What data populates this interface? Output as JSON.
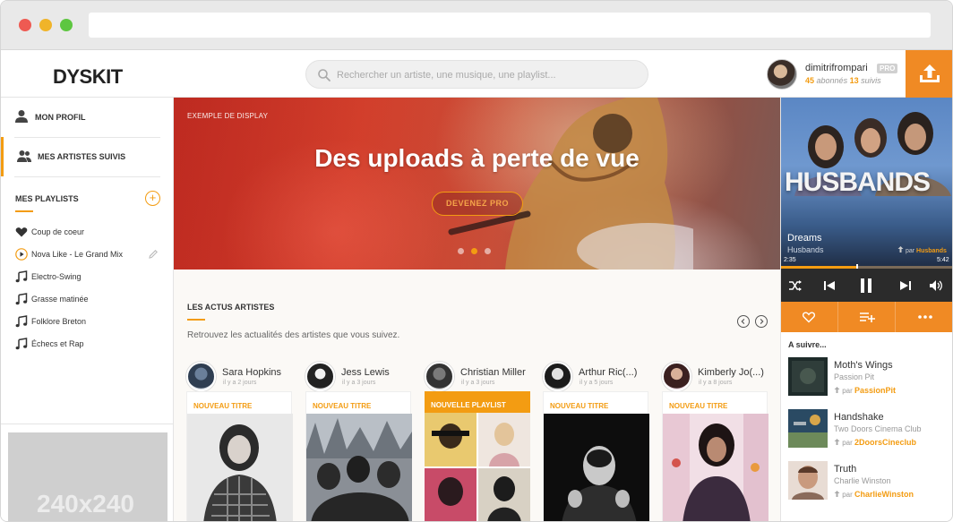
{
  "header": {
    "logo": "DYSKIT",
    "search_placeholder": "Rechercher un artiste, une musique, une playlist...",
    "user": {
      "name": "dimitrifrompari",
      "badge": "PRO",
      "followers_count": "45",
      "followers_label": "abonnés",
      "following_count": "13",
      "following_label": "suivis"
    }
  },
  "sidebar": {
    "nav": [
      {
        "label": "MON PROFIL",
        "icon": "user-icon"
      },
      {
        "label": "MES ARTISTES SUIVIS",
        "icon": "users-icon"
      }
    ],
    "playlists_title": "MES PLAYLISTS",
    "playlists": [
      {
        "label": "Coup de coeur",
        "icon": "heart-icon"
      },
      {
        "label": "Nova Like - Le Grand Mix",
        "icon": "play-circle-icon"
      },
      {
        "label": "Electro-Swing",
        "icon": "music-note-icon"
      },
      {
        "label": "Grasse matinée",
        "icon": "music-note-icon"
      },
      {
        "label": "Folklore Breton",
        "icon": "music-note-icon"
      },
      {
        "label": "Échecs et Rap",
        "icon": "music-note-icon"
      }
    ],
    "ad_label": "240x240"
  },
  "hero": {
    "tag": "EXEMPLE DE DISPLAY",
    "title": "Des uploads à perte de vue",
    "button": "DEVENEZ PRO",
    "active_slide": 2,
    "slide_count": 3
  },
  "news": {
    "title": "LES ACTUS ARTISTES",
    "subtitle": "Retrouvez les actualités des artistes que vous suivez.",
    "cards": [
      {
        "name": "Sara Hopkins",
        "time": "il y a 2 jours",
        "tag": "NOUVEAU TITRE",
        "highlight": false
      },
      {
        "name": "Jess Lewis",
        "time": "il y a 3 jours",
        "tag": "NOUVEAU TITRE",
        "highlight": false
      },
      {
        "name": "Christian Miller",
        "time": "il y a 3 jours",
        "tag": "NOUVELLE PLAYLIST",
        "highlight": true
      },
      {
        "name": "Arthur Ric(...)",
        "time": "il y a 5 jours",
        "tag": "NOUVEAU TITRE",
        "highlight": false
      },
      {
        "name": "Kimberly Jo(...)",
        "time": "il y a 8 jours",
        "tag": "NOUVEAU TITRE",
        "highlight": false
      }
    ]
  },
  "player": {
    "album_word": "HUSBANDS",
    "track": "Dreams",
    "artist": "Husbands",
    "by_label": "par",
    "uploader": "Husbands",
    "time_elapsed": "2:35",
    "time_total": "5:42",
    "progress": 0.44,
    "next_title": "A suivre...",
    "queue": [
      {
        "title": "Moth's Wings",
        "artist": "Passion Pit",
        "by_label": "par",
        "uploader": "PassionPit"
      },
      {
        "title": "Handshake",
        "artist": "Two Doors Cinema Club",
        "by_label": "par",
        "uploader": "2DoorsCineclub"
      },
      {
        "title": "Truth",
        "artist": "Charlie Winston",
        "by_label": "par",
        "uploader": "CharlieWinston"
      }
    ]
  },
  "colors": {
    "accent": "#f39c12",
    "upload": "#f08a24",
    "player_controls": "#2b2b2b"
  }
}
